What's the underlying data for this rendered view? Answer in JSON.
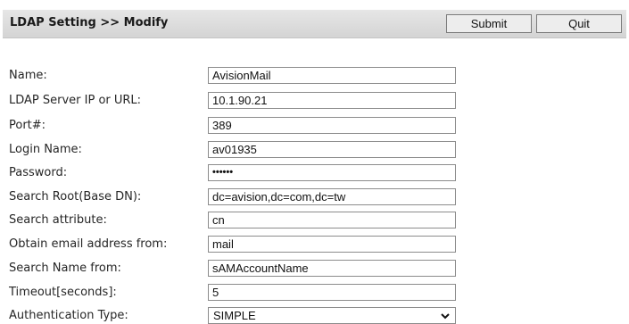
{
  "header": {
    "title": "LDAP Setting >> Modify",
    "submit_label": "Submit",
    "quit_label": "Quit"
  },
  "form": {
    "name": {
      "label": "Name:",
      "value": "AvisionMail"
    },
    "server": {
      "label": "LDAP Server IP or URL:",
      "value": "10.1.90.21"
    },
    "port": {
      "label": "Port#:",
      "value": "389"
    },
    "login": {
      "label": "Login Name:",
      "value": "av01935"
    },
    "password": {
      "label": "Password:",
      "value": "••••••"
    },
    "search_root": {
      "label": "Search Root(Base DN):",
      "value": "dc=avision,dc=com,dc=tw"
    },
    "search_attribute": {
      "label": "Search attribute:",
      "value": "cn"
    },
    "email_from": {
      "label": "Obtain email address from:",
      "value": "mail"
    },
    "search_name_from": {
      "label": "Search Name from:",
      "value": "sAMAccountName"
    },
    "timeout": {
      "label": "Timeout[seconds]:",
      "value": "5"
    },
    "auth_type": {
      "label": "Authentication Type:",
      "value": "SIMPLE"
    }
  }
}
